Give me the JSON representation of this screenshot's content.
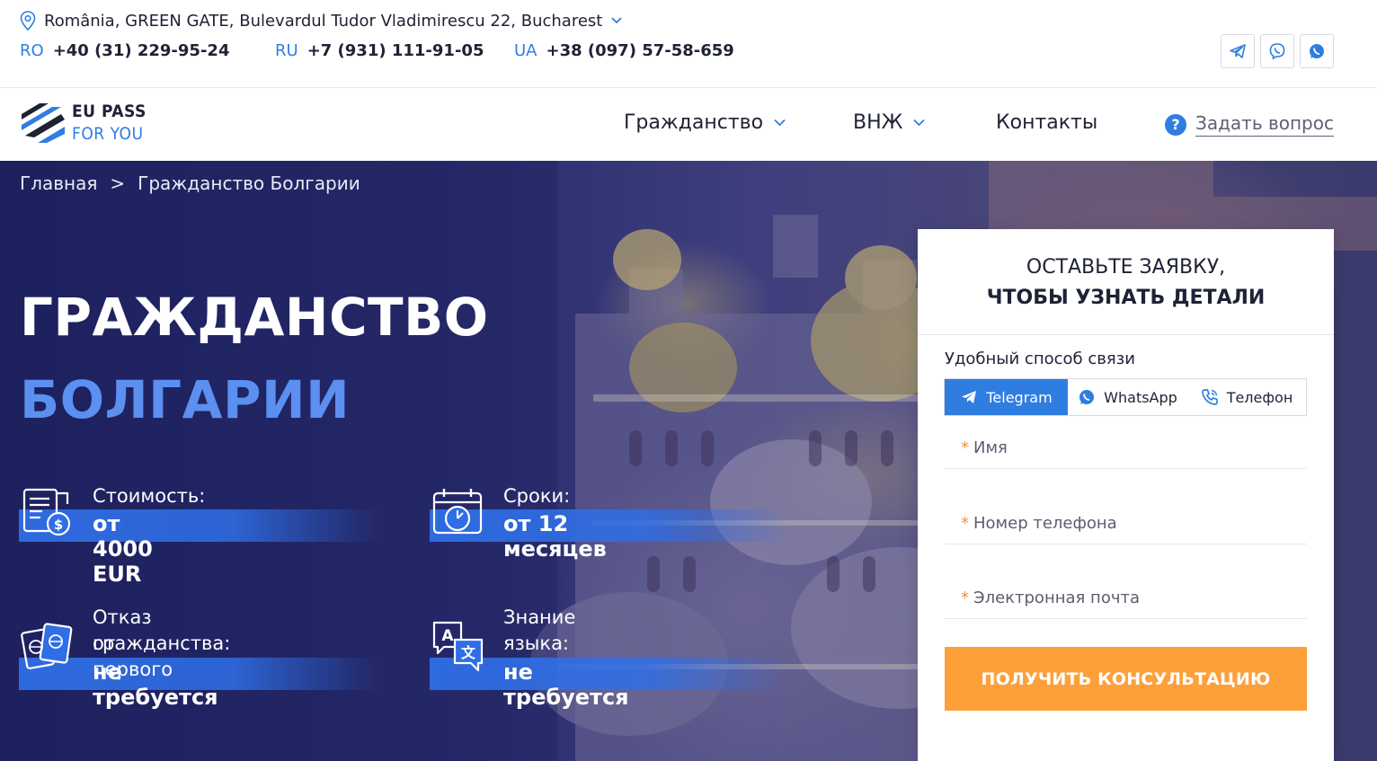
{
  "topbar": {
    "address": "România, GREEN GATE, Bulevardul Tudor Vladimirescu 22, Bucharest",
    "phones": [
      {
        "code": "RO",
        "number": "+40 (31) 229-95-24"
      },
      {
        "code": "RU",
        "number": "+7 (931) 111-91-05"
      },
      {
        "code": "UA",
        "number": "+38 (097) 57-58-659"
      }
    ],
    "social_icons": [
      "telegram-icon",
      "viber-icon",
      "whatsapp-icon"
    ]
  },
  "logo": {
    "line1": "EU PASS",
    "line2": "FOR YOU"
  },
  "nav": {
    "items": [
      "Гражданство",
      "ВНЖ",
      "Контакты"
    ],
    "ask_label": "Задать вопрос"
  },
  "breadcrumb": {
    "home": "Главная",
    "separator": ">",
    "current": "Гражданство Болгарии"
  },
  "hero": {
    "title_line1": "ГРАЖДАНСТВО",
    "title_line2": "БОЛГАРИИ",
    "features": [
      {
        "icon": "document-dollar-icon",
        "label": "Стоимость:",
        "value": "от 4000 EUR"
      },
      {
        "icon": "calendar-clock-icon",
        "label": "Сроки:",
        "value": "от 12 месяцев"
      },
      {
        "icon": "passports-icon",
        "label_line1": "Отказ от первого",
        "label_line2": "гражданства:",
        "value": "не требуется"
      },
      {
        "icon": "translate-icon",
        "label_line1": "Знание",
        "label_line2": "языка:",
        "value": "не требуется"
      }
    ]
  },
  "form": {
    "title_line1": "ОСТАВЬТЕ ЗАЯВКУ,",
    "title_line2": "ЧТОБЫ УЗНАТЬ ДЕТАЛИ",
    "contact_label": "Удобный способ связи",
    "tabs": [
      "Telegram",
      "WhatsApp",
      "Телефон"
    ],
    "fields": [
      "Имя",
      "Номер телефона",
      "Электронная почта"
    ],
    "required_mark": "*",
    "submit": "ПОЛУЧИТЬ КОНСУЛЬТАЦИЮ"
  },
  "colors": {
    "accent": "#2f7de1",
    "cta": "#fea03a",
    "hero_title_highlight": "#5b8ff0"
  }
}
